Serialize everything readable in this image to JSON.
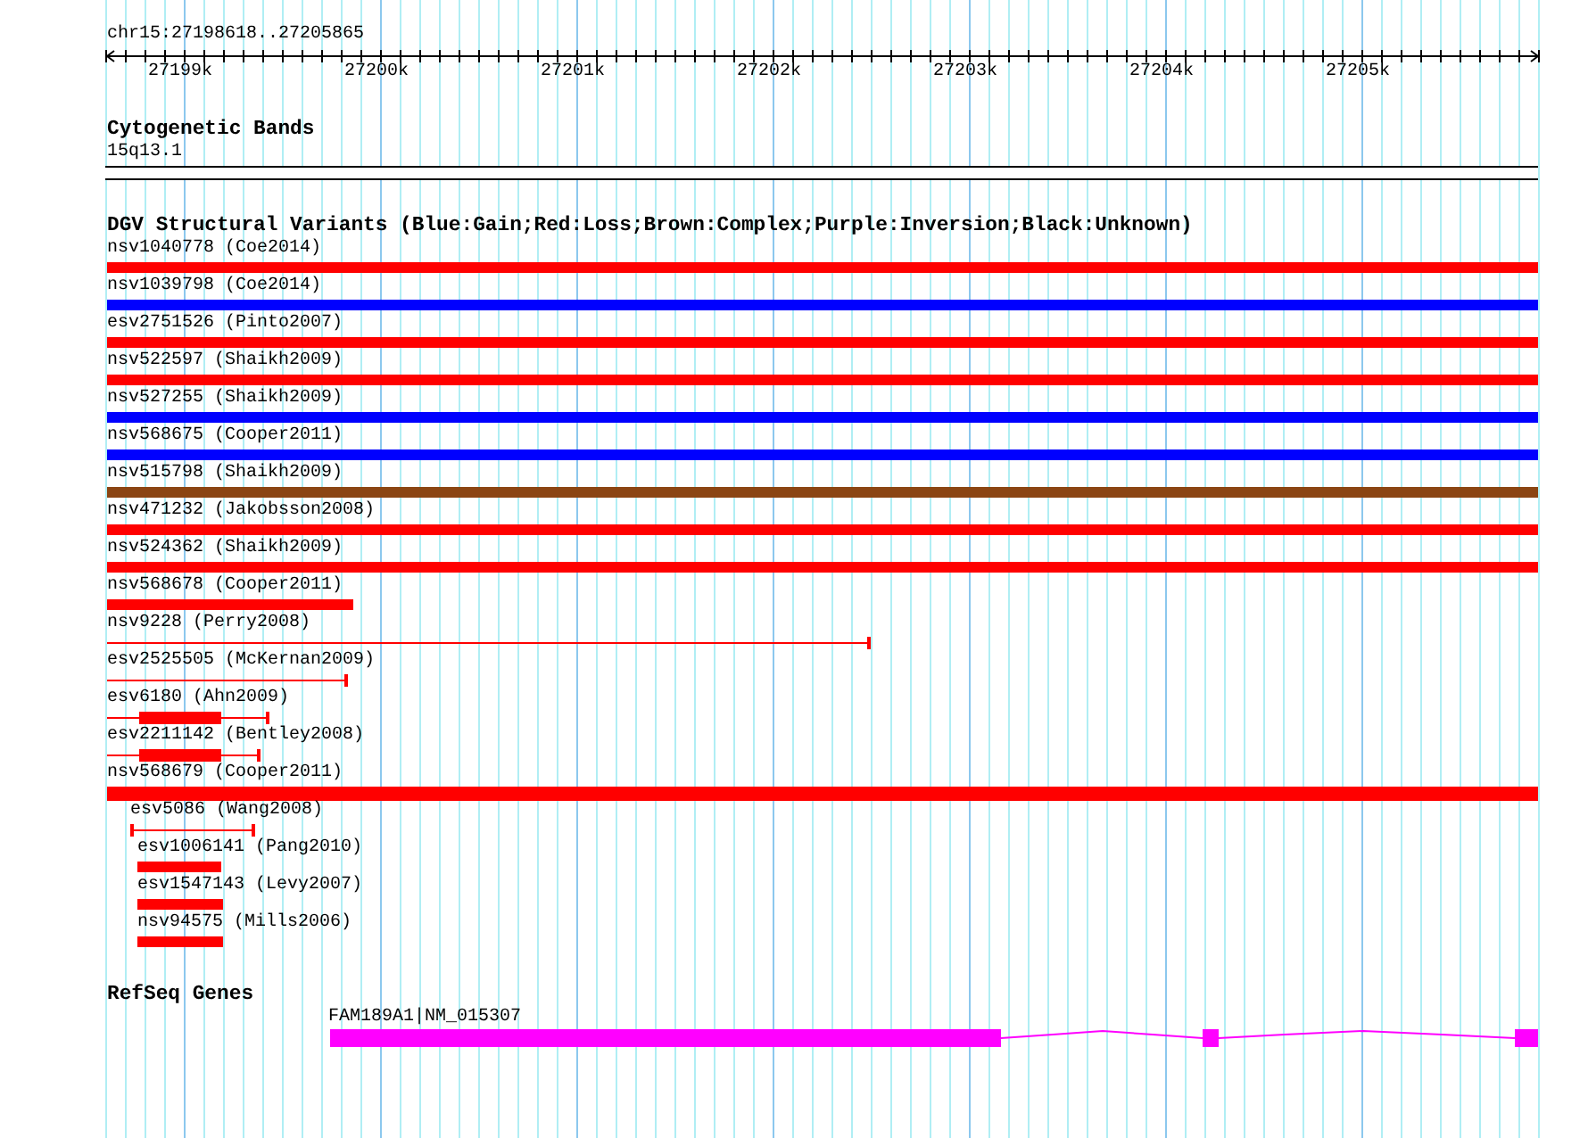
{
  "ruler": {
    "location": "chr15:27198618..27205865",
    "ticks": [
      "27199k",
      "27200k",
      "27201k",
      "27202k",
      "27203k",
      "27204k",
      "27205k"
    ]
  },
  "tracks": [
    {
      "kind": "cytoband",
      "title": "Cytogenetic Bands",
      "bands": [
        {
          "label": "15q13.1"
        }
      ]
    },
    {
      "kind": "variants",
      "title": "DGV Structural Variants (Blue:Gain;Red:Loss;Brown:Complex;Purple:Inversion;Black:Unknown)",
      "features": [
        {
          "label": "nsv1040778 (Coe2014)",
          "kind": "bar",
          "color": "#ff0000"
        },
        {
          "label": "nsv1039798 (Coe2014)",
          "kind": "bar",
          "color": "#0000ff"
        },
        {
          "label": "esv2751526 (Pinto2007)",
          "kind": "bar",
          "color": "#ff0000"
        },
        {
          "label": "nsv522597 (Shaikh2009)",
          "kind": "bar",
          "color": "#ff0000"
        },
        {
          "label": "nsv527255 (Shaikh2009)",
          "kind": "bar",
          "color": "#0000ff"
        },
        {
          "label": "nsv568675 (Cooper2011)",
          "kind": "bar",
          "color": "#0000ff"
        },
        {
          "label": "nsv515798 (Shaikh2009)",
          "kind": "bar",
          "color": "#8b4513"
        },
        {
          "label": "nsv471232 (Jakobsson2008)",
          "kind": "bar",
          "color": "#ff0000"
        },
        {
          "label": "nsv524362 (Shaikh2009)",
          "kind": "bar",
          "color": "#ff0000"
        },
        {
          "label": "nsv568678 (Cooper2011)",
          "kind": "bar",
          "color": "#ff0000"
        },
        {
          "label": "nsv9228 (Perry2008)",
          "kind": "line",
          "color": "#ff0000"
        },
        {
          "label": "esv2525505 (McKernan2009)",
          "kind": "line",
          "color": "#ff0000"
        },
        {
          "label": "esv6180 (Ahn2009)",
          "kind": "line-block",
          "color": "#ff0000"
        },
        {
          "label": "esv2211142 (Bentley2008)",
          "kind": "line-block",
          "color": "#ff0000"
        },
        {
          "label": "nsv568679 (Cooper2011)",
          "kind": "bar",
          "color": "#ff0000"
        },
        {
          "label": "esv5086 (Wang2008)",
          "kind": "line",
          "color": "#ff0000"
        },
        {
          "label": "esv1006141 (Pang2010)",
          "kind": "bar",
          "color": "#ff0000"
        },
        {
          "label": "esv1547143 (Levy2007)",
          "kind": "bar",
          "color": "#ff0000"
        },
        {
          "label": "nsv94575 (Mills2006)",
          "kind": "bar",
          "color": "#ff0000"
        }
      ]
    },
    {
      "kind": "genes",
      "title": "RefSeq Genes",
      "genes": [
        {
          "label": "FAM189A1|NM_015307",
          "color": "#ff00ff"
        }
      ]
    }
  ]
}
